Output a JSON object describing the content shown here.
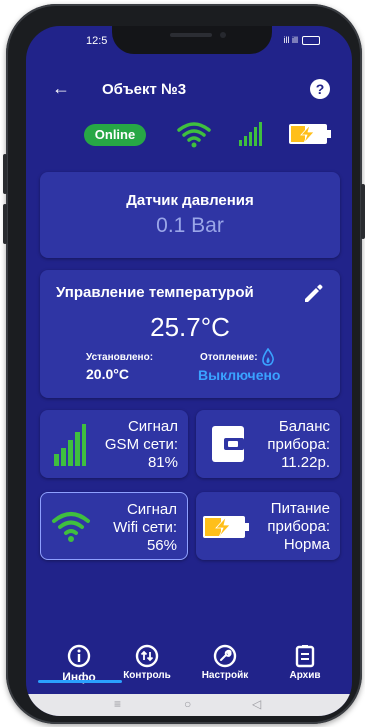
{
  "status_bar": {
    "time": "12:5",
    "signal_text": "ill ill",
    "battery_text": ""
  },
  "header": {
    "back_icon": "←",
    "title": "Объект №3",
    "help_icon": "?"
  },
  "status_row": {
    "online_label": "Online"
  },
  "pressure_card": {
    "title": "Датчик давления",
    "value": "0.1 Bar"
  },
  "temperature_card": {
    "title": "Управление температурой",
    "current": "25.7°C",
    "set_label": "Установлено:",
    "set_value": "20.0°C",
    "heating_label": "Отопление:",
    "heating_status": "Выключено"
  },
  "tiles": {
    "gsm": {
      "line1": "Сигнал",
      "line2": "GSM сети:",
      "line3": "81%",
      "level": 0.81
    },
    "balance": {
      "line1": "Баланс",
      "line2": "прибора:",
      "line3": "11.22р."
    },
    "wifi": {
      "line1": "Сигнал",
      "line2": "Wifi сети:",
      "line3": "56%",
      "level": 0.56
    },
    "power": {
      "line1": "Питание",
      "line2": "прибора:",
      "line3": "Норма"
    }
  },
  "nav": {
    "info": "Инфо",
    "control": "Контроль",
    "settings": "Настройк",
    "archive": "Архив"
  },
  "system_nav": {
    "menu": "≡",
    "home": "○",
    "back": "◁"
  },
  "colors": {
    "background": "#21238a",
    "card": "#2f35a4",
    "online": "#27a745",
    "accent_green": "#3fbf3f",
    "battery_yellow": "#ffbf1a",
    "heating_blue": "#3aa2ff"
  }
}
